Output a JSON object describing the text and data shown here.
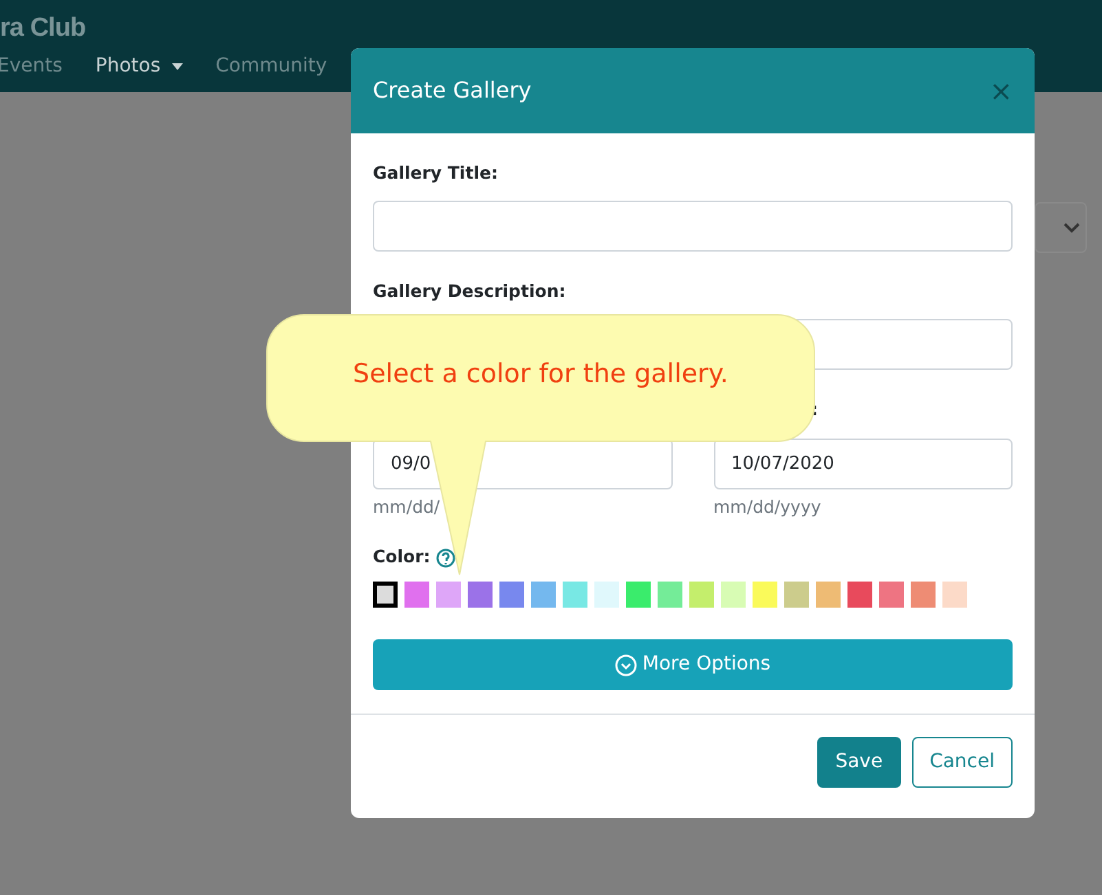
{
  "navbar": {
    "brand": "ra Club",
    "links": [
      {
        "label": "Events",
        "selected": false,
        "dropdown": false
      },
      {
        "label": "Photos",
        "selected": true,
        "dropdown": true
      },
      {
        "label": "Community",
        "selected": false,
        "dropdown": false
      }
    ]
  },
  "modal": {
    "title": "Create Gallery",
    "close": "×",
    "title_field": {
      "label": "Gallery Title:"
    },
    "description_field": {
      "label": "Gallery Description:"
    },
    "start_date": {
      "value": "09/0",
      "hint": "mm/dd/"
    },
    "end_date": {
      "label": ":",
      "value": "10/07/2020",
      "hint": "mm/dd/yyyy"
    },
    "color_label": "Color:",
    "swatches": [
      {
        "color": "#dcdcdc",
        "selected": true
      },
      {
        "color": "#e070ee",
        "selected": false
      },
      {
        "color": "#dea6f8",
        "selected": false
      },
      {
        "color": "#9b72e8",
        "selected": false
      },
      {
        "color": "#7888ee",
        "selected": false
      },
      {
        "color": "#74b8ee",
        "selected": false
      },
      {
        "color": "#78e8e4",
        "selected": false
      },
      {
        "color": "#e0f8fc",
        "selected": false
      },
      {
        "color": "#3aec6c",
        "selected": false
      },
      {
        "color": "#74ec98",
        "selected": false
      },
      {
        "color": "#c4ee6c",
        "selected": false
      },
      {
        "color": "#d8fcb4",
        "selected": false
      },
      {
        "color": "#fafa5a",
        "selected": false
      },
      {
        "color": "#cccc8c",
        "selected": false
      },
      {
        "color": "#eebb74",
        "selected": false
      },
      {
        "color": "#e84a5c",
        "selected": false
      },
      {
        "color": "#ee7482",
        "selected": false
      },
      {
        "color": "#ee8c74",
        "selected": false
      },
      {
        "color": "#fcdac8",
        "selected": false
      }
    ],
    "more_options": "More Options",
    "buttons": [
      {
        "label": "Save",
        "kind": "primary"
      },
      {
        "label": "Cancel",
        "kind": "outline"
      }
    ]
  },
  "callout": {
    "text": "Select a color for the gallery."
  }
}
